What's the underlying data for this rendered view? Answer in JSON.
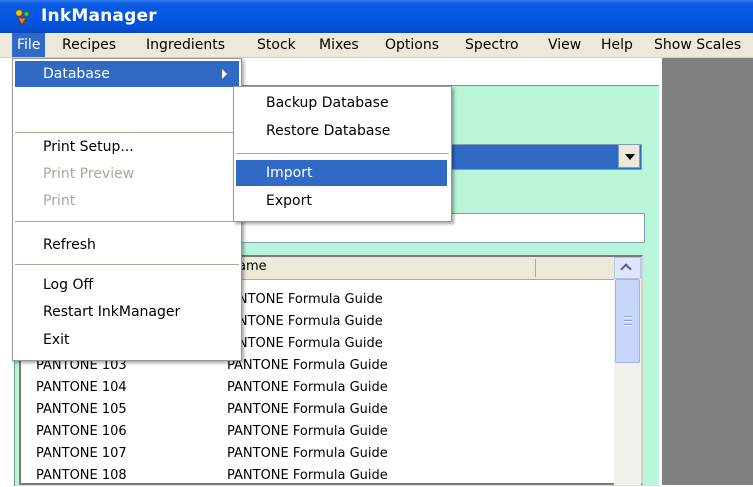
{
  "window": {
    "title": "InkManager"
  },
  "menubar": {
    "items": [
      {
        "label": "File"
      },
      {
        "label": "Recipes"
      },
      {
        "label": "Ingredients"
      },
      {
        "label": "Stock"
      },
      {
        "label": "Mixes"
      },
      {
        "label": "Options"
      },
      {
        "label": "Spectro"
      },
      {
        "label": "View"
      },
      {
        "label": "Help"
      },
      {
        "label": "Show Scales"
      }
    ]
  },
  "file_menu": {
    "items": [
      {
        "label": "Database"
      },
      {
        "label": "Print Setup..."
      },
      {
        "label": "Print Preview"
      },
      {
        "label": "Print"
      },
      {
        "label": "Refresh"
      },
      {
        "label": "Log Off"
      },
      {
        "label": "Restart InkManager"
      },
      {
        "label": "Exit"
      }
    ]
  },
  "database_submenu": {
    "items": [
      {
        "label": "Backup Database"
      },
      {
        "label": "Restore Database"
      },
      {
        "label": "Import"
      },
      {
        "label": "Export"
      }
    ]
  },
  "list": {
    "header_name_partial": "ame",
    "rows_behind_menu": [
      {
        "name": "ANTONE Formula Guide"
      },
      {
        "name": "ANTONE Formula Guide"
      },
      {
        "name": "ANTONE Formula Guide"
      }
    ],
    "rows": [
      {
        "code": "PANTONE 103",
        "name": "PANTONE Formula Guide"
      },
      {
        "code": "PANTONE 104",
        "name": "PANTONE Formula Guide"
      },
      {
        "code": "PANTONE 105",
        "name": "PANTONE Formula Guide"
      },
      {
        "code": "PANTONE 106",
        "name": "PANTONE Formula Guide"
      },
      {
        "code": "PANTONE 107",
        "name": "PANTONE Formula Guide"
      },
      {
        "code": "PANTONE 108",
        "name": "PANTONE Formula Guide"
      }
    ]
  },
  "colors": {
    "title_blue": "#0556e4",
    "highlight_blue": "#316ac5",
    "panel_green": "#b8f5d9",
    "menubar_gray": "#ece9d8"
  }
}
